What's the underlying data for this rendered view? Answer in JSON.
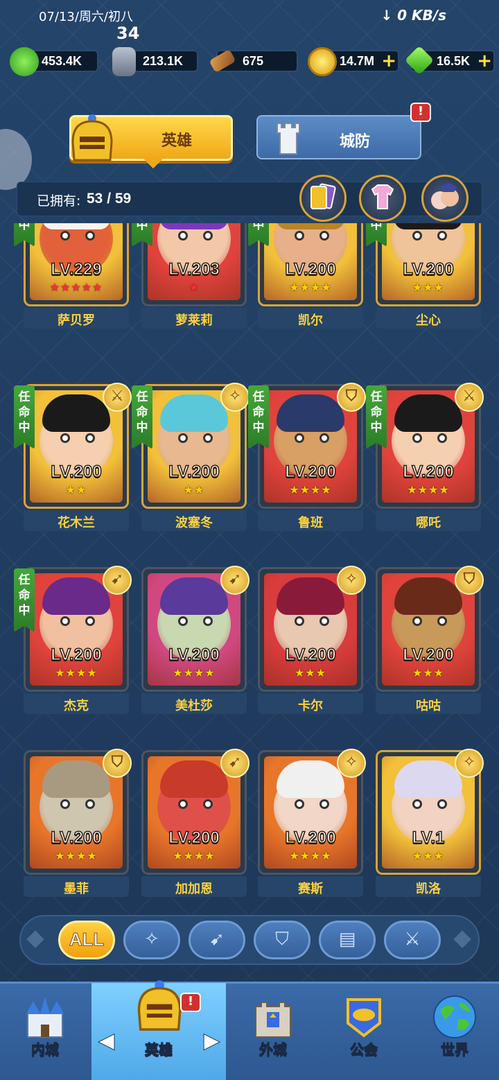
{
  "status": {
    "datetime": "07/13/周六/初八",
    "badge_number": "34",
    "network": "↓ 0 KB/s"
  },
  "resources": [
    {
      "name": "exp",
      "value": "453.4K",
      "icon": "exp-gem-icon",
      "color": "#46c23a",
      "plus": ""
    },
    {
      "name": "stone",
      "value": "213.1K",
      "icon": "stone-tablet-icon",
      "color": "#8a96a8",
      "plus": ""
    },
    {
      "name": "hammer",
      "value": "675",
      "icon": "hammer-icon",
      "color": "#c9883a",
      "plus": ""
    },
    {
      "name": "gold",
      "value": "14.7M",
      "icon": "gold-coin-icon",
      "color": "#f2c128",
      "plus": "+"
    },
    {
      "name": "gem",
      "value": "16.5K",
      "icon": "green-gem-icon",
      "color": "#4fd02c",
      "plus": "+"
    }
  ],
  "tabs": {
    "hero": "英雄",
    "city_defense": "城防",
    "city_defense_alert": "!"
  },
  "owned": {
    "label": "已拥有:",
    "count": "53 / 59"
  },
  "ribbon_text": "任命中",
  "heroes": [
    {
      "name": "萨贝罗",
      "level": "LV.229",
      "stars": "★★★★★",
      "star_color": "red",
      "bg": "#f2c03a",
      "skin": "#e2603a",
      "hair": "#f4f4f4",
      "role": "",
      "appointed": true
    },
    {
      "name": "萝莱莉",
      "level": "LV.203",
      "stars": "★",
      "star_color": "red",
      "bg": "#e0433c",
      "skin": "#f2c8a8",
      "hair": "#7a3ab8",
      "role": "",
      "appointed": true
    },
    {
      "name": "凯尔",
      "level": "LV.200",
      "stars": "★★★★",
      "star_color": "gold",
      "bg": "#f2c03a",
      "skin": "#e8b08a",
      "hair": "#b88428",
      "role": "",
      "appointed": true
    },
    {
      "name": "尘心",
      "level": "LV.200",
      "stars": "★★★",
      "star_color": "gold",
      "bg": "#f2c03a",
      "skin": "#f0c49a",
      "hair": "#1e1a1a",
      "role": "",
      "appointed": true
    },
    {
      "name": "花木兰",
      "level": "LV.200",
      "stars": "★★",
      "star_color": "gold",
      "bg": "#f2c03a",
      "skin": "#f5cfb0",
      "hair": "#1a1a1a",
      "role": "⚔",
      "appointed": true
    },
    {
      "name": "波塞冬",
      "level": "LV.200",
      "stars": "★★",
      "star_color": "gold",
      "bg": "#f2c03a",
      "skin": "#e8b890",
      "hair": "#5ac8d8",
      "role": "✧",
      "appointed": true
    },
    {
      "name": "鲁班",
      "level": "LV.200",
      "stars": "★★★★",
      "star_color": "gold",
      "bg": "#e0433c",
      "skin": "#d8a064",
      "hair": "#2a3a6a",
      "role": "⛉",
      "appointed": true
    },
    {
      "name": "哪吒",
      "level": "LV.200",
      "stars": "★★★★",
      "star_color": "gold",
      "bg": "#e0433c",
      "skin": "#f5d0b0",
      "hair": "#1a1a1a",
      "role": "⚔",
      "appointed": true
    },
    {
      "name": "杰克",
      "level": "LV.200",
      "stars": "★★★★",
      "star_color": "gold",
      "bg": "#e0433c",
      "skin": "#f0c0a0",
      "hair": "#6a2a8a",
      "role": "➹",
      "appointed": true
    },
    {
      "name": "美杜莎",
      "level": "LV.200",
      "stars": "★★★★",
      "star_color": "gold",
      "bg": "#d04880",
      "skin": "#c8d8b0",
      "hair": "#5a3a9a",
      "role": "➹",
      "appointed": false
    },
    {
      "name": "卡尔",
      "level": "LV.200",
      "stars": "★★★",
      "star_color": "gold",
      "bg": "#d83c3c",
      "skin": "#e8c8b0",
      "hair": "#8a1a3a",
      "role": "✧",
      "appointed": false
    },
    {
      "name": "咕咕",
      "level": "LV.200",
      "stars": "★★★",
      "star_color": "gold",
      "bg": "#e0433c",
      "skin": "#c89a5a",
      "hair": "#6a2a1a",
      "role": "⛉",
      "appointed": false
    },
    {
      "name": "墨菲",
      "level": "LV.200",
      "stars": "★★★★",
      "star_color": "gold",
      "bg": "#e8762a",
      "skin": "#cfc6b0",
      "hair": "#a89a80",
      "role": "⛉",
      "appointed": false
    },
    {
      "name": "加加恩",
      "level": "LV.200",
      "stars": "★★★★",
      "star_color": "gold",
      "bg": "#e8762a",
      "skin": "#e0504a",
      "hair": "#c83a2a",
      "role": "➹",
      "appointed": false
    },
    {
      "name": "赛斯",
      "level": "LV.200",
      "stars": "★★★★",
      "star_color": "gold",
      "bg": "#e8762a",
      "skin": "#f2d6c8",
      "hair": "#f0f0f0",
      "role": "✧",
      "appointed": false
    },
    {
      "name": "凯洛",
      "level": "LV.1",
      "stars": "★★★",
      "star_color": "gold",
      "bg": "#f2c03a",
      "skin": "#f2d2c0",
      "hair": "#dcd8f0",
      "role": "✧",
      "appointed": false
    }
  ],
  "filters": [
    {
      "label": "ALL",
      "icon": "all-filter",
      "active": true
    },
    {
      "label": "",
      "icon": "mage-filter-icon",
      "glyph": "✧"
    },
    {
      "label": "",
      "icon": "archer-filter-icon",
      "glyph": "➹"
    },
    {
      "label": "",
      "icon": "tank-filter-icon",
      "glyph": "⛉"
    },
    {
      "label": "",
      "icon": "book-filter-icon",
      "glyph": "▤"
    },
    {
      "label": "",
      "icon": "sword-filter-icon",
      "glyph": "⚔"
    }
  ],
  "nav": [
    {
      "label": "内城",
      "icon": "castle-icon"
    },
    {
      "label": "英雄",
      "icon": "hero-helmet-icon",
      "active": true,
      "alert": "!"
    },
    {
      "label": "外城",
      "icon": "outer-city-icon"
    },
    {
      "label": "公会",
      "icon": "guild-handshake-icon"
    },
    {
      "label": "世界",
      "icon": "world-globe-icon"
    }
  ],
  "nav_arrows": {
    "left": "◀",
    "right": "▶"
  }
}
